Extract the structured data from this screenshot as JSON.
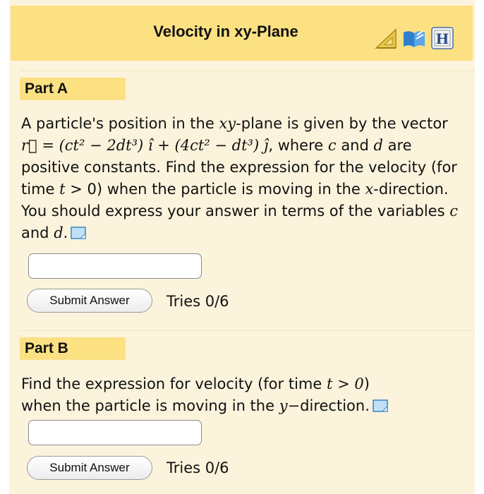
{
  "header": {
    "title": "Velocity in xy-Plane",
    "icons": [
      "ruler-triangle-icon",
      "book-icon",
      "hint-h-icon"
    ]
  },
  "parts": [
    {
      "label": "Part A",
      "question_prefix": "A particle's position in the ",
      "question_xy": "xy",
      "question_after_xy": "-plane is given by the vector ",
      "vector_expression": "r⃗ = (ct² − 2dt³) î + (4ct² − dt³) ĵ",
      "question_where": ", where ",
      "var_c": "c",
      "question_and": " and ",
      "var_d": "d",
      "question_mid": " are positive constants. Find the expression for the velocity (for time ",
      "var_t": "t",
      "question_cond": " > 0) when the particle is moving in the ",
      "var_x": "x",
      "question_dir": "-direction. You should express your answer in terms of the variables ",
      "math_c": "c",
      "math_and": " and ",
      "math_d": "d",
      "math_end": ".",
      "answer_value": "",
      "submit_label": "Submit Answer",
      "tries": "Tries 0/6"
    },
    {
      "label": "Part B",
      "question_prefix": "Find the expression for velocity (for time ",
      "math_cond": "t > 0",
      "question_close": ")",
      "question_line2": "when the particle is moving in the ",
      "math_dir": "y−",
      "question_dir": "direction.",
      "answer_value": "",
      "submit_label": "Submit Answer",
      "tries": "Tries 0/6"
    }
  ]
}
